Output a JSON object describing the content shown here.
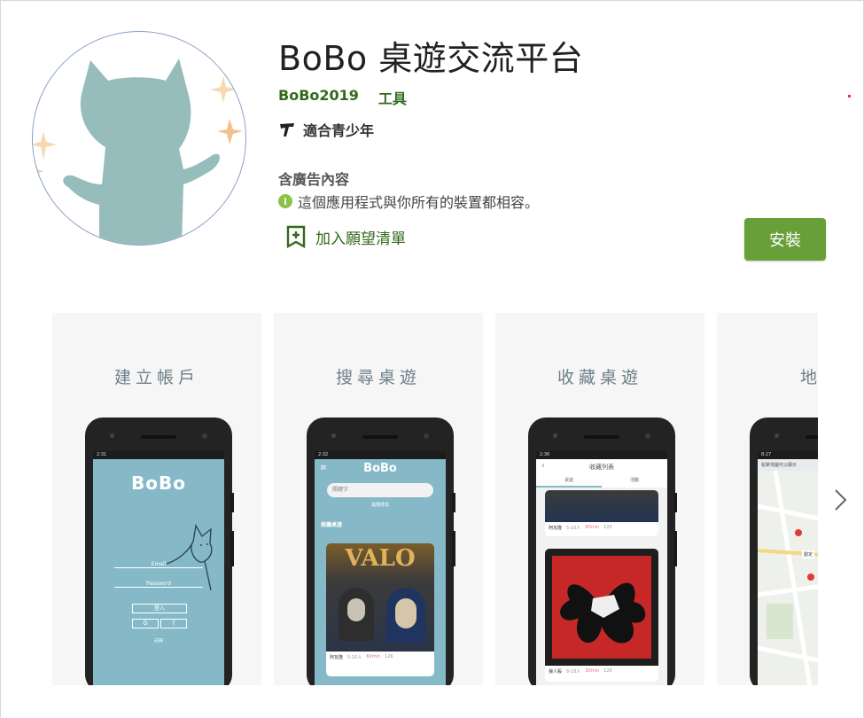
{
  "app": {
    "title": "BoBo 桌遊交流平台",
    "developer": "BoBo2019",
    "category": "工具",
    "content_rating": "適合青少年",
    "ads_label": "含廣告內容",
    "compatibility": "這個應用程式與你所有的裝置都相容。",
    "wishlist_label": "加入願望清單",
    "install_label": "安裝"
  },
  "colors": {
    "brand_green": "#33691e",
    "install_green": "#689f38",
    "teal_screen": "#86b9c8",
    "mascot": "#96bcbc"
  },
  "screenshots": [
    {
      "title": "建立帳戶",
      "status_time": "2:31",
      "logo": "BoBo",
      "email_label": "Email",
      "password_label": "Password",
      "login_label": "登入",
      "google_label": "G",
      "facebook_label": "f",
      "register_label": "註冊"
    },
    {
      "title": "搜尋桌遊",
      "status_time": "2:32",
      "logo": "BoBo",
      "search_placeholder": "關鍵字",
      "advanced_search": "進階搜尋",
      "section_label": "推薦桌遊",
      "game_art_text": "VALO",
      "game_name": "阿瓦隆",
      "players": "5-10人",
      "duration": "60min",
      "likes": "126"
    },
    {
      "title": "收藏桌遊",
      "status_time": "2:36",
      "header": "收藏列表",
      "tab_left": "桌遊",
      "tab_right": "活動",
      "game1_name": "阿瓦隆",
      "game1_players": "5-10人",
      "game1_duration": "60min",
      "game1_likes": "125",
      "game2_name": "狼人殺",
      "game2_players": "8-18人",
      "game2_duration": "30min",
      "game2_likes": "126"
    },
    {
      "title": "地圖",
      "status_time": "8:27",
      "map_hint": "點擊地圖可以顯示",
      "map_label": "劉定"
    }
  ],
  "icons": {
    "rating": "teen-rating-icon",
    "info": "info-icon",
    "wishlist": "bookmark-add-icon",
    "next": "chevron-right-icon"
  }
}
